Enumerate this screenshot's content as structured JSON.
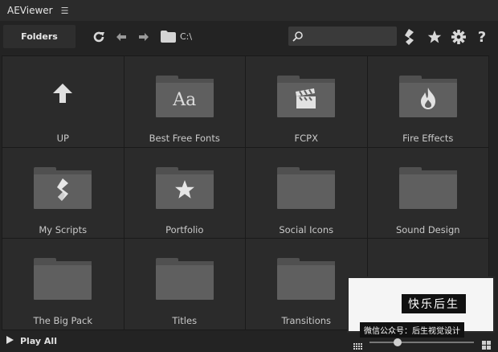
{
  "app": {
    "title": "AEViewer"
  },
  "toolbar": {
    "folders_tab": "Folders",
    "path": "C:\\",
    "search_placeholder": ""
  },
  "grid": [
    {
      "label": "UP",
      "icon": "up-arrow-icon"
    },
    {
      "label": "Best Free Fonts",
      "icon": "font-aa-icon",
      "glyph": "Aa"
    },
    {
      "label": "FCPX",
      "icon": "clapperboard-icon"
    },
    {
      "label": "Fire Effects",
      "icon": "flame-icon"
    },
    {
      "label": "My Scripts",
      "icon": "script-icon"
    },
    {
      "label": "Portfolio",
      "icon": "star-icon"
    },
    {
      "label": "Social Icons",
      "icon": "folder-icon"
    },
    {
      "label": "Sound Design",
      "icon": "folder-icon"
    },
    {
      "label": "The Big Pack",
      "icon": "folder-icon"
    },
    {
      "label": "Titles",
      "icon": "folder-icon"
    },
    {
      "label": "Transitions",
      "icon": "folder-icon"
    }
  ],
  "bottom": {
    "play_all": "Play All",
    "zoom_level": 0.27
  },
  "watermark": {
    "line1": "快乐后生",
    "line2": "微信公众号：后生视觉设计"
  },
  "colors": {
    "bg": "#232323",
    "panel": "#2b2b2b",
    "folder": "#5f5f5f"
  }
}
